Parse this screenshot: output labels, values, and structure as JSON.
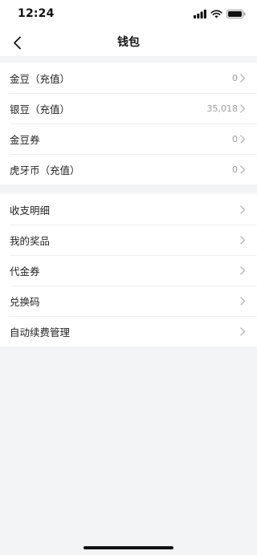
{
  "status_bar": {
    "time": "12:24"
  },
  "nav": {
    "title": "钱包"
  },
  "wallet_section": {
    "items": [
      {
        "label": "金豆（充值）",
        "value": "0"
      },
      {
        "label": "银豆（充值）",
        "value": "35,018"
      },
      {
        "label": "金豆券",
        "value": "0"
      },
      {
        "label": "虎牙币（充值）",
        "value": "0"
      }
    ]
  },
  "menu_section": {
    "items": [
      {
        "label": "收支明细"
      },
      {
        "label": "我的奖品"
      },
      {
        "label": "代金券"
      },
      {
        "label": "兑换码"
      },
      {
        "label": "自动续费管理"
      }
    ]
  },
  "icons": [
    "back-arrow-icon",
    "chevron-right-icon",
    "signal-icon",
    "wifi-icon",
    "battery-icon"
  ],
  "colors": {
    "background": "#f3f4f6",
    "card": "#ffffff",
    "value_text": "#9a9a9a",
    "chevron": "#b8b8b8"
  }
}
